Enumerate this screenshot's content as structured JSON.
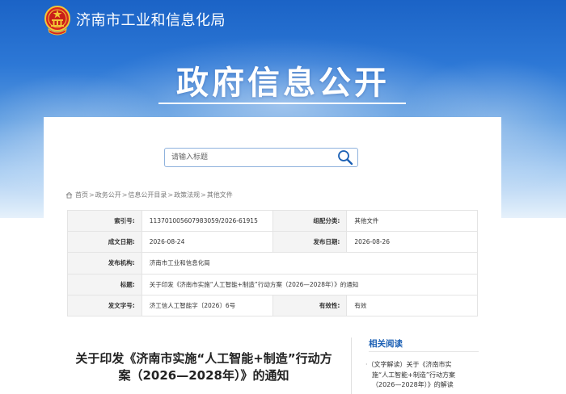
{
  "header": {
    "site_name": "济南市工业和信息化局",
    "logo_icon": "national-emblem-icon"
  },
  "banner": {
    "title": "政府信息公开"
  },
  "search": {
    "placeholder": "请输入标题",
    "icon": "search-icon"
  },
  "breadcrumb": {
    "icon": "home-icon",
    "items": [
      "首页",
      "政务公开",
      "信息公开目录",
      "政策法规",
      "其他文件"
    ],
    "separator": ">"
  },
  "meta": {
    "index_label": "索引号:",
    "index_value": "113701005607983059/2026-61915",
    "category_label": "组配分类:",
    "category_value": "其他文件",
    "created_label": "成文日期:",
    "created_value": "2026-08-24",
    "published_label": "发布日期:",
    "published_value": "2026-08-26",
    "issuer_label": "发布机构:",
    "issuer_value": "济南市工业和信息化局",
    "title_label": "标题:",
    "title_value": "关于印发《济南市实施“人工智能+制造”行动方案（2026—2028年）》的通知",
    "docno_label": "发文字号:",
    "docno_value": "济工信人工智能字〔2026〕6号",
    "validity_label": "有效性:",
    "validity_value": "有效"
  },
  "document": {
    "title_line1": "关于印发《济南市实施“人工智能+制造”行动方",
    "title_line2": "案（2026—2028年）》的通知"
  },
  "related": {
    "heading": "相关阅读",
    "items": [
      {
        "bullet": "·",
        "line1": "（文字解读）关于《济南市实",
        "line2": "施“人工智能+制造”行动方案",
        "line3": "（2026—2028年）》的解读"
      }
    ]
  },
  "colors": {
    "banner_top": "#1b63c6",
    "link_blue": "#1a5fb4",
    "label_bg": "#f4f4f4"
  }
}
